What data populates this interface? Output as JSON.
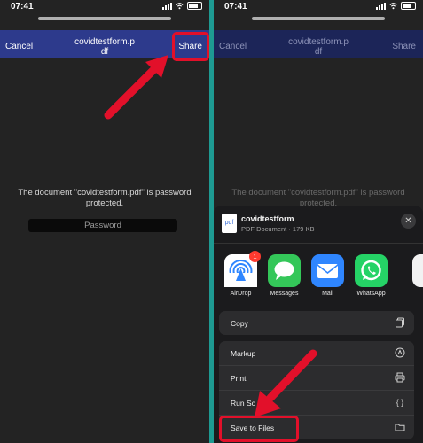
{
  "left": {
    "status": {
      "time": "07:41"
    },
    "nav": {
      "cancel": "Cancel",
      "title": "covidtestform.p\ndf",
      "share": "Share"
    },
    "message": "The document \"covidtestform.pdf\" is password protected.",
    "password_placeholder": "Password"
  },
  "right": {
    "status": {
      "time": "07:41"
    },
    "nav": {
      "cancel": "Cancel",
      "title": "covidtestform.p\ndf",
      "share": "Share"
    },
    "message": "The document \"covidtestform.pdf\" is password protected.",
    "sheet": {
      "file_icon": "pdf",
      "file_name": "covidtestform",
      "file_meta": "PDF Document · 179 KB",
      "apps": [
        {
          "label": "AirDrop",
          "icon": "airdrop-icon",
          "badge": "1"
        },
        {
          "label": "Messages",
          "icon": "messages-icon"
        },
        {
          "label": "Mail",
          "icon": "mail-icon"
        },
        {
          "label": "WhatsApp",
          "icon": "whatsapp-icon"
        }
      ],
      "actions_top": [
        {
          "label": "Copy",
          "icon": "copy-icon"
        }
      ],
      "actions": [
        {
          "label": "Markup",
          "icon": "markup-icon"
        },
        {
          "label": "Print",
          "icon": "print-icon"
        },
        {
          "label": "Run Sc",
          "icon": "braces-icon",
          "glyph": "{ }"
        },
        {
          "label": "Save to Files",
          "icon": "folder-icon"
        }
      ]
    }
  },
  "colors": {
    "accent_nav": "#2d3a8c",
    "highlight": "#e2102a",
    "divider": "#1e9a92"
  }
}
